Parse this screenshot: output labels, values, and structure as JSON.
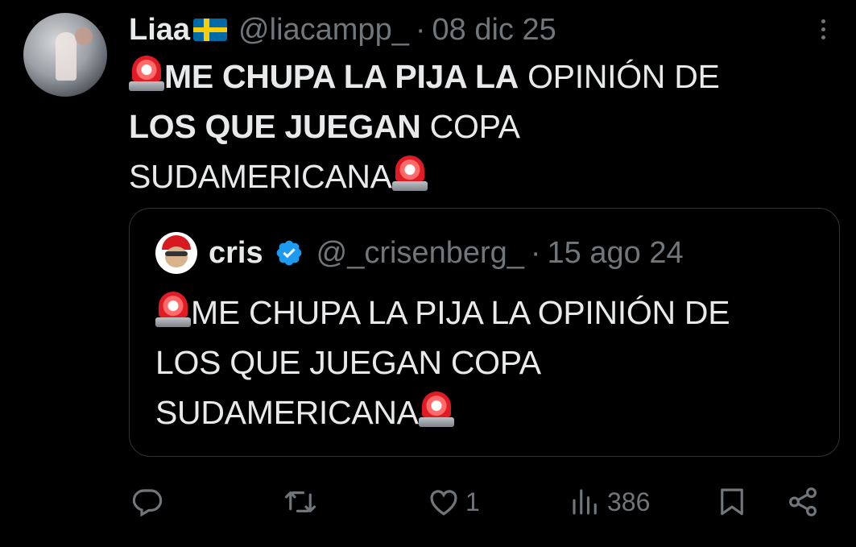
{
  "tweet": {
    "name": "Liaa",
    "flag_icon": "sweden-flag-icon",
    "handle": "@liacampp_",
    "separator": "·",
    "date": "08 dic 25",
    "text_bold_1": "ME CHUPA LA PIJA LA",
    "text_normal_1": " OPINIÓN DE",
    "text_bold_2": "LOS QUE JUEGAN",
    "text_normal_2": " COPA",
    "text_normal_3": "SUDAMERICANA"
  },
  "quoted": {
    "name": "cris",
    "verified": true,
    "handle": "@_crisenberg_",
    "separator": "·",
    "date": "15 ago 24",
    "line_1": "ME CHUPA LA PIJA LA OPINIÓN DE",
    "line_2": "LOS QUE JUEGAN COPA",
    "line_3": "SUDAMERICANA"
  },
  "actions": {
    "reply_count": "",
    "retweet_count": "",
    "like_count": "1",
    "views_count": "386"
  },
  "colors": {
    "background": "#000000",
    "text": "#e7e9ea",
    "secondary": "#71767b",
    "verified": "#1d9bf0",
    "border": "#2f3336"
  }
}
